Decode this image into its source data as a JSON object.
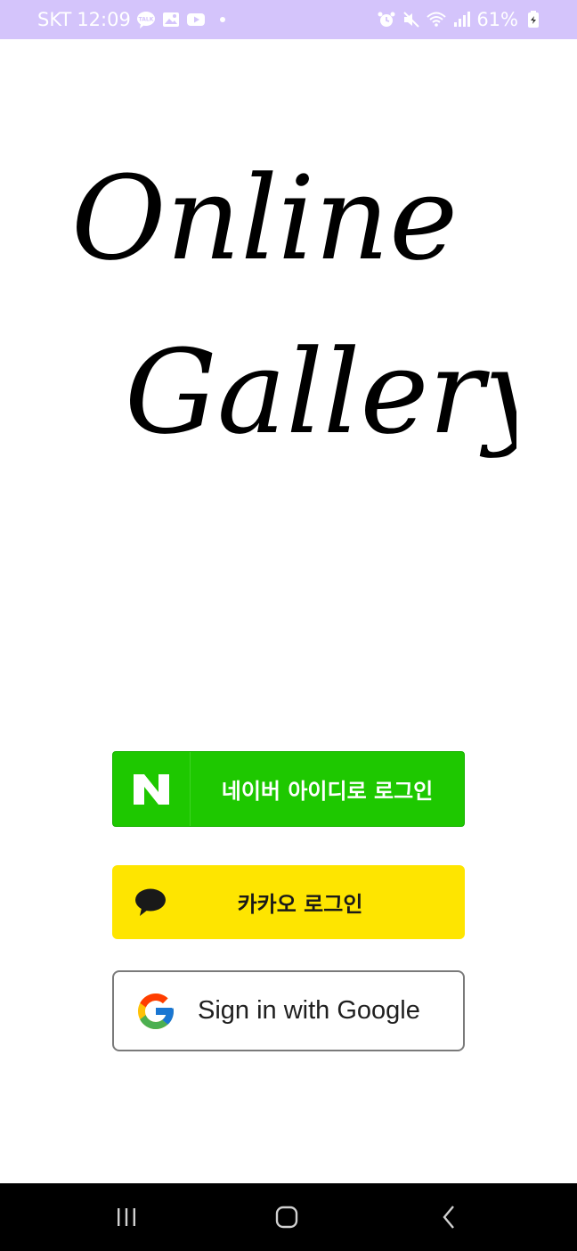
{
  "status_bar": {
    "carrier": "SKT",
    "time": "12:09",
    "battery_percent": "61%",
    "left_icons": [
      "talk-icon",
      "gallery-icon",
      "youtube-icon"
    ],
    "right_icons": [
      "alarm-icon",
      "mute-icon",
      "wifi-icon",
      "signal-icon",
      "battery-icon"
    ],
    "background": "#d4c4fb"
  },
  "logo": {
    "line1": "Online",
    "line2": "Gallery"
  },
  "login": {
    "naver_label": "네이버 아이디로 로그인",
    "naver_icon_letter": "N",
    "kakao_label": "카카오 로그인",
    "google_label": "Sign in with Google",
    "colors": {
      "naver": "#1ec800",
      "kakao": "#fee500",
      "google_border": "#7a7a7a"
    }
  },
  "nav_bar": {
    "buttons": [
      "recent-apps-icon",
      "home-icon",
      "back-icon"
    ]
  }
}
